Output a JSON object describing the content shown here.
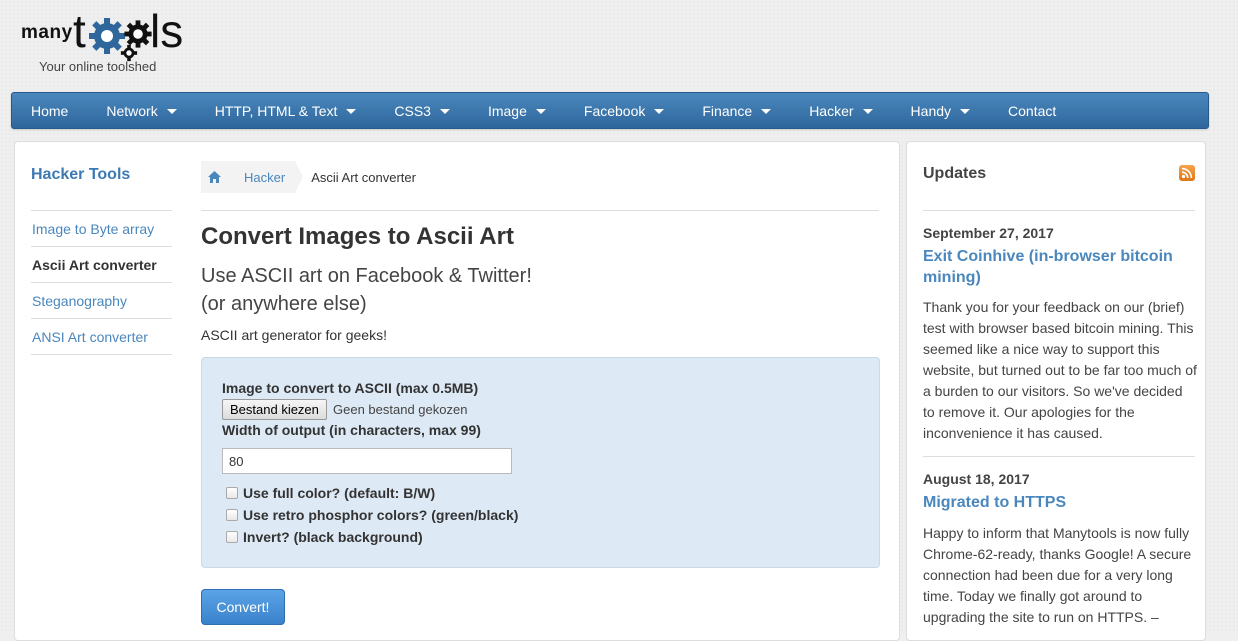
{
  "brand": {
    "logo_many": "many",
    "logo_t": "t",
    "logo_ls": "ls",
    "tagline": "Your online toolshed"
  },
  "nav": [
    {
      "label": "Home",
      "dropdown": false
    },
    {
      "label": "Network",
      "dropdown": true
    },
    {
      "label": "HTTP, HTML & Text",
      "dropdown": true
    },
    {
      "label": "CSS3",
      "dropdown": true
    },
    {
      "label": "Image",
      "dropdown": true
    },
    {
      "label": "Facebook",
      "dropdown": true
    },
    {
      "label": "Finance",
      "dropdown": true
    },
    {
      "label": "Hacker",
      "dropdown": true
    },
    {
      "label": "Handy",
      "dropdown": true
    },
    {
      "label": "Contact",
      "dropdown": false
    }
  ],
  "sidebar": {
    "title": "Hacker Tools",
    "items": [
      {
        "label": "Image to Byte array",
        "active": false
      },
      {
        "label": "Ascii Art converter",
        "active": true
      },
      {
        "label": "Steganography",
        "active": false
      },
      {
        "label": "ANSI Art converter",
        "active": false
      }
    ]
  },
  "breadcrumb": {
    "home_icon": "home-icon",
    "link": "Hacker",
    "current": "Ascii Art converter"
  },
  "main": {
    "title": "Convert Images to Ascii Art",
    "subtitle_line1": "Use ASCII art on Facebook & Twitter!",
    "subtitle_line2": "(or anywhere else)",
    "lead": "ASCII art generator for geeks!"
  },
  "form": {
    "file_label": "Image to convert to ASCII (max 0.5MB)",
    "file_button": "Bestand kiezen",
    "file_none": "Geen bestand gekozen",
    "width_label": "Width of output (in characters, max 99)",
    "width_value": "80",
    "options": [
      {
        "label": "Use full color? (default: B/W)",
        "checked": false
      },
      {
        "label": "Use retro phosphor colors? (green/black)",
        "checked": false
      },
      {
        "label": "Invert? (black background)",
        "checked": false
      }
    ],
    "submit": "Convert!"
  },
  "updates": {
    "title": "Updates",
    "rss_icon": "rss-icon",
    "entries": [
      {
        "date": "September 27, 2017",
        "title": "Exit Coinhive (in-browser bitcoin mining)",
        "body": "Thank you for your feedback on our (brief) test with browser based bitcoin mining. This seemed like a nice way to support this website, but turned out to be far too much of a burden to our visitors. So we've decided to remove it. Our apologies for the inconvenience it has caused."
      },
      {
        "date": "August 18, 2017",
        "title": "Migrated to HTTPS",
        "body": "Happy to inform that Manytools is now fully Chrome-62-ready, thanks Google! A secure connection had been due for a very long time. Today we finally got around to upgrading the site to run on HTTPS. –"
      }
    ]
  },
  "colors": {
    "nav_top": "#4a87bd",
    "nav_bottom": "#2f679c",
    "link": "#4a87bd",
    "form_bg": "#dde9f5",
    "button": "#3a83cc"
  }
}
